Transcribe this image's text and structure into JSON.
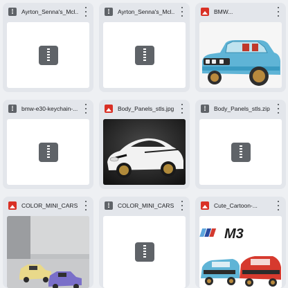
{
  "files": [
    {
      "name": "Ayrton_Senna's_Mcl...",
      "type": "zip",
      "file_icon": "zip-file-icon"
    },
    {
      "name": "Ayrton_Senna's_Mcl...",
      "type": "zip",
      "file_icon": "zip-file-icon"
    },
    {
      "name": "BMW...",
      "type": "image",
      "file_icon": "image-file-icon"
    },
    {
      "name": "bmw-e30-keychain-...",
      "type": "zip",
      "file_icon": "zip-file-icon"
    },
    {
      "name": "Body_Panels_stls.jpg",
      "type": "image",
      "file_icon": "image-file-icon"
    },
    {
      "name": "Body_Panels_stls.zip",
      "type": "zip",
      "file_icon": "zip-file-icon"
    },
    {
      "name": "COLOR_MINI_CARS.j...",
      "type": "image",
      "file_icon": "image-file-icon"
    },
    {
      "name": "COLOR_MINI_CARS....",
      "type": "zip",
      "file_icon": "zip-file-icon"
    },
    {
      "name": "Cute_Cartoon-...",
      "type": "image",
      "file_icon": "image-file-icon"
    }
  ],
  "thumbnail_text": {
    "m3_logo": "M3"
  },
  "colors": {
    "image_icon": "#d93025",
    "zip_icon": "#5f6368",
    "card_bg": "#e3e6eb",
    "page_bg": "#eef0f3"
  }
}
